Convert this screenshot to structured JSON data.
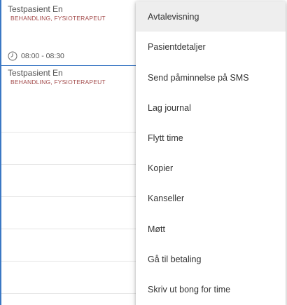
{
  "calendar": {
    "appointments": [
      {
        "patient": "Testpasient En",
        "type": "BEHANDLING, FYSIOTERAPEUT",
        "time": "08:00 - 08:30"
      },
      {
        "patient": "Testpasient En",
        "type": "BEHANDLING, FYSIOTERAPEUT"
      }
    ],
    "accent_color": "#3b78c4",
    "type_color": "#a34b4b",
    "clock_icon": "clock-icon"
  },
  "context_menu": {
    "items": [
      {
        "label": "Avtalevisning",
        "highlighted": true
      },
      {
        "label": "Pasientdetaljer"
      },
      {
        "label": "Send påminnelse på SMS"
      },
      {
        "label": "Lag journal"
      },
      {
        "label": "Flytt time"
      },
      {
        "label": "Kopier"
      },
      {
        "label": "Kanseller"
      },
      {
        "label": "Møtt"
      },
      {
        "label": "Gå til betaling"
      },
      {
        "label": "Skriv ut bong for time"
      }
    ]
  }
}
